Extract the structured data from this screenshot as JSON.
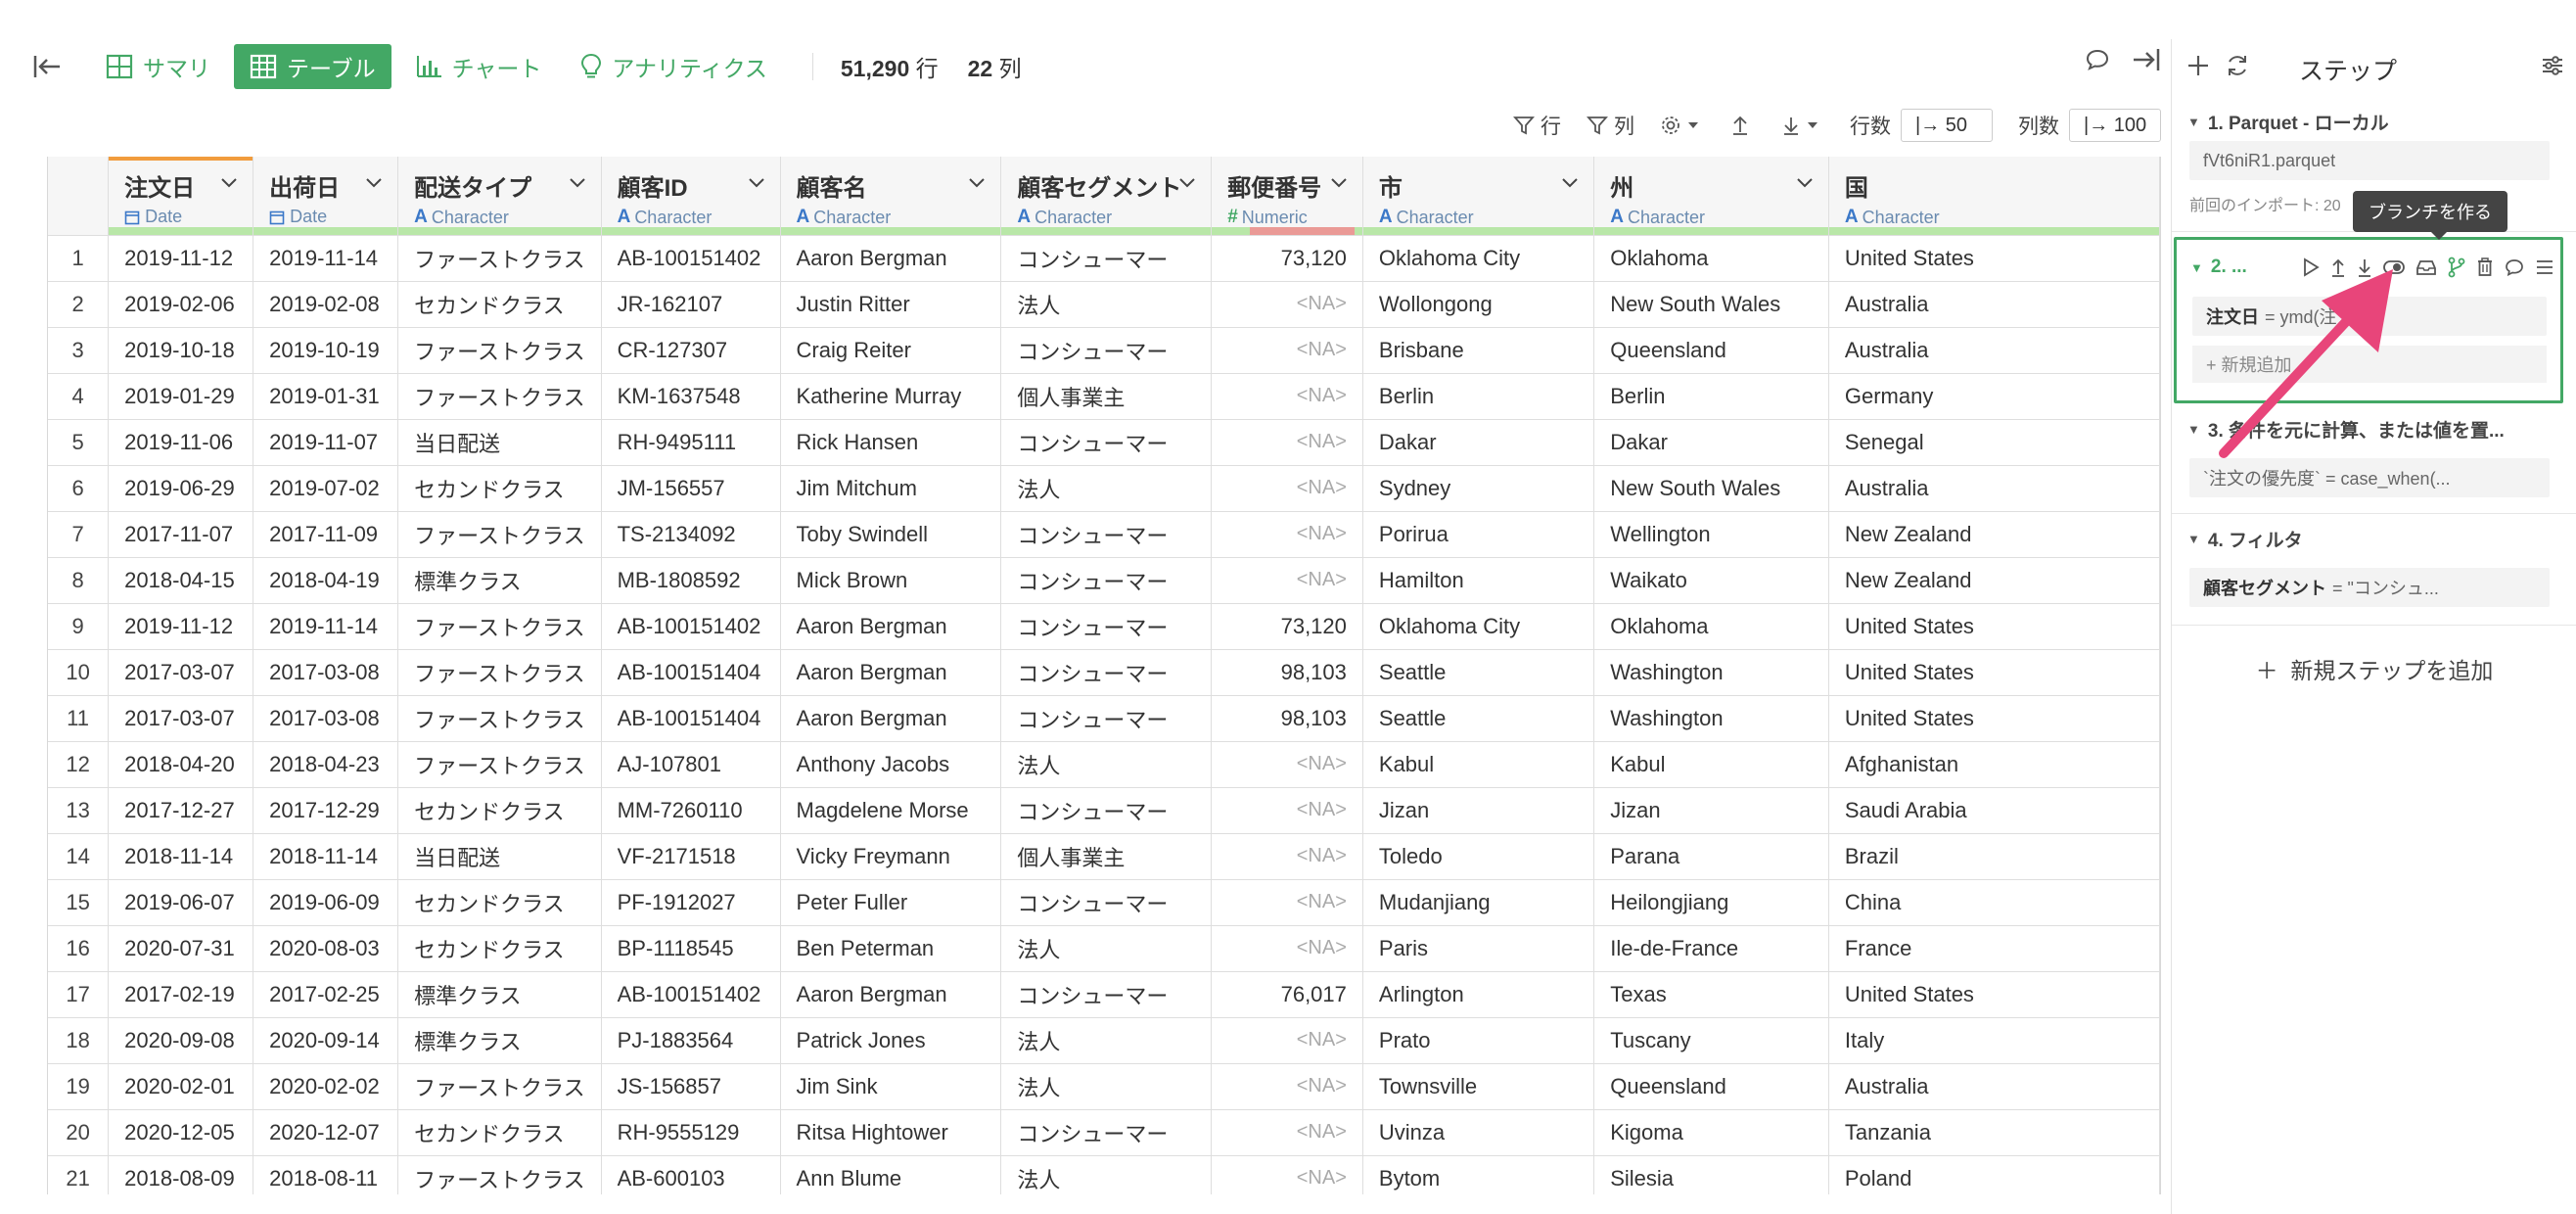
{
  "toolbar": {
    "tabs": [
      {
        "label": "サマリ",
        "icon": "summary-grid-icon"
      },
      {
        "label": "テーブル",
        "icon": "table-icon",
        "active": true
      },
      {
        "label": "チャート",
        "icon": "bar-chart-icon"
      },
      {
        "label": "アナリティクス",
        "icon": "lightbulb-icon"
      }
    ],
    "row_count": "51,290",
    "row_unit": "行",
    "col_count": "22",
    "col_unit": "列"
  },
  "subbar": {
    "row_filter": "行",
    "col_filter": "列",
    "rows_label": "行数",
    "rows_value": "50",
    "cols_label": "列数",
    "cols_value": "100"
  },
  "columns": [
    {
      "name": "注文日",
      "type": "Date",
      "type_icon": "calendar-icon"
    },
    {
      "name": "出荷日",
      "type": "Date",
      "type_icon": "calendar-icon"
    },
    {
      "name": "配送タイプ",
      "type": "Character",
      "type_icon": "A"
    },
    {
      "name": "顧客ID",
      "type": "Character",
      "type_icon": "A"
    },
    {
      "name": "顧客名",
      "type": "Character",
      "type_icon": "A"
    },
    {
      "name": "顧客セグメント",
      "type": "Character",
      "type_icon": "A"
    },
    {
      "name": "郵便番号",
      "type": "Numeric",
      "type_icon": "#"
    },
    {
      "name": "市",
      "type": "Character",
      "type_icon": "A"
    },
    {
      "name": "州",
      "type": "Character",
      "type_icon": "A"
    },
    {
      "name": "国",
      "type": "Character",
      "type_icon": "A"
    }
  ],
  "rows": [
    [
      "1",
      "2019-11-12",
      "2019-11-14",
      "ファーストクラス",
      "AB-100151402",
      "Aaron Bergman",
      "コンシューマー",
      "73,120",
      "Oklahoma City",
      "Oklahoma",
      "United States"
    ],
    [
      "2",
      "2019-02-06",
      "2019-02-08",
      "セカンドクラス",
      "JR-162107",
      "Justin Ritter",
      "法人",
      "<NA>",
      "Wollongong",
      "New South Wales",
      "Australia"
    ],
    [
      "3",
      "2019-10-18",
      "2019-10-19",
      "ファーストクラス",
      "CR-127307",
      "Craig Reiter",
      "コンシューマー",
      "<NA>",
      "Brisbane",
      "Queensland",
      "Australia"
    ],
    [
      "4",
      "2019-01-29",
      "2019-01-31",
      "ファーストクラス",
      "KM-1637548",
      "Katherine Murray",
      "個人事業主",
      "<NA>",
      "Berlin",
      "Berlin",
      "Germany"
    ],
    [
      "5",
      "2019-11-06",
      "2019-11-07",
      "当日配送",
      "RH-9495111",
      "Rick Hansen",
      "コンシューマー",
      "<NA>",
      "Dakar",
      "Dakar",
      "Senegal"
    ],
    [
      "6",
      "2019-06-29",
      "2019-07-02",
      "セカンドクラス",
      "JM-156557",
      "Jim Mitchum",
      "法人",
      "<NA>",
      "Sydney",
      "New South Wales",
      "Australia"
    ],
    [
      "7",
      "2017-11-07",
      "2017-11-09",
      "ファーストクラス",
      "TS-2134092",
      "Toby Swindell",
      "コンシューマー",
      "<NA>",
      "Porirua",
      "Wellington",
      "New Zealand"
    ],
    [
      "8",
      "2018-04-15",
      "2018-04-19",
      "標準クラス",
      "MB-1808592",
      "Mick Brown",
      "コンシューマー",
      "<NA>",
      "Hamilton",
      "Waikato",
      "New Zealand"
    ],
    [
      "9",
      "2019-11-12",
      "2019-11-14",
      "ファーストクラス",
      "AB-100151402",
      "Aaron Bergman",
      "コンシューマー",
      "73,120",
      "Oklahoma City",
      "Oklahoma",
      "United States"
    ],
    [
      "10",
      "2017-03-07",
      "2017-03-08",
      "ファーストクラス",
      "AB-100151404",
      "Aaron Bergman",
      "コンシューマー",
      "98,103",
      "Seattle",
      "Washington",
      "United States"
    ],
    [
      "11",
      "2017-03-07",
      "2017-03-08",
      "ファーストクラス",
      "AB-100151404",
      "Aaron Bergman",
      "コンシューマー",
      "98,103",
      "Seattle",
      "Washington",
      "United States"
    ],
    [
      "12",
      "2018-04-20",
      "2018-04-23",
      "ファーストクラス",
      "AJ-107801",
      "Anthony Jacobs",
      "法人",
      "<NA>",
      "Kabul",
      "Kabul",
      "Afghanistan"
    ],
    [
      "13",
      "2017-12-27",
      "2017-12-29",
      "セカンドクラス",
      "MM-7260110",
      "Magdelene Morse",
      "コンシューマー",
      "<NA>",
      "Jizan",
      "Jizan",
      "Saudi Arabia"
    ],
    [
      "14",
      "2018-11-14",
      "2018-11-14",
      "当日配送",
      "VF-2171518",
      "Vicky Freymann",
      "個人事業主",
      "<NA>",
      "Toledo",
      "Parana",
      "Brazil"
    ],
    [
      "15",
      "2019-06-07",
      "2019-06-09",
      "セカンドクラス",
      "PF-1912027",
      "Peter Fuller",
      "コンシューマー",
      "<NA>",
      "Mudanjiang",
      "Heilongjiang",
      "China"
    ],
    [
      "16",
      "2020-07-31",
      "2020-08-03",
      "セカンドクラス",
      "BP-1118545",
      "Ben Peterman",
      "法人",
      "<NA>",
      "Paris",
      "Ile-de-France",
      "France"
    ],
    [
      "17",
      "2017-02-19",
      "2017-02-25",
      "標準クラス",
      "AB-100151402",
      "Aaron Bergman",
      "コンシューマー",
      "76,017",
      "Arlington",
      "Texas",
      "United States"
    ],
    [
      "18",
      "2020-09-08",
      "2020-09-14",
      "標準クラス",
      "PJ-1883564",
      "Patrick Jones",
      "法人",
      "<NA>",
      "Prato",
      "Tuscany",
      "Italy"
    ],
    [
      "19",
      "2020-02-01",
      "2020-02-02",
      "ファーストクラス",
      "JS-156857",
      "Jim Sink",
      "法人",
      "<NA>",
      "Townsville",
      "Queensland",
      "Australia"
    ],
    [
      "20",
      "2020-12-05",
      "2020-12-07",
      "セカンドクラス",
      "RH-9555129",
      "Ritsa Hightower",
      "コンシューマー",
      "<NA>",
      "Uvinza",
      "Kigoma",
      "Tanzania"
    ],
    [
      "21",
      "2018-08-09",
      "2018-08-11",
      "ファーストクラス",
      "AB-600103",
      "Ann Blume",
      "法人",
      "<NA>",
      "Bytom",
      "Silesia",
      "Poland"
    ]
  ],
  "panel": {
    "title": "ステップ",
    "steps": [
      {
        "header": "1. Parquet - ローカル",
        "body": "fVt6niR1.parquet",
        "note": "前回のインポート: 20"
      },
      {
        "header": "2. ...",
        "body_key": "注文日",
        "body_val": "= ymd(注",
        "add": "+ 新規追加"
      },
      {
        "header": "3. 条件を元に計算、または値を置...",
        "body": "`注文の優先度` = case_when(..."
      },
      {
        "header": "4. フィルタ",
        "body_key": "顧客セグメント",
        "body_val": "= \"コンシュ..."
      }
    ],
    "add_step": "新規ステップを追加",
    "tooltip": "ブランチを作る"
  },
  "colors": {
    "accent": "#43a865",
    "arrow": "#e8457a",
    "na_bar": "#ea9a96",
    "ok_bar": "#b9e7a8"
  }
}
